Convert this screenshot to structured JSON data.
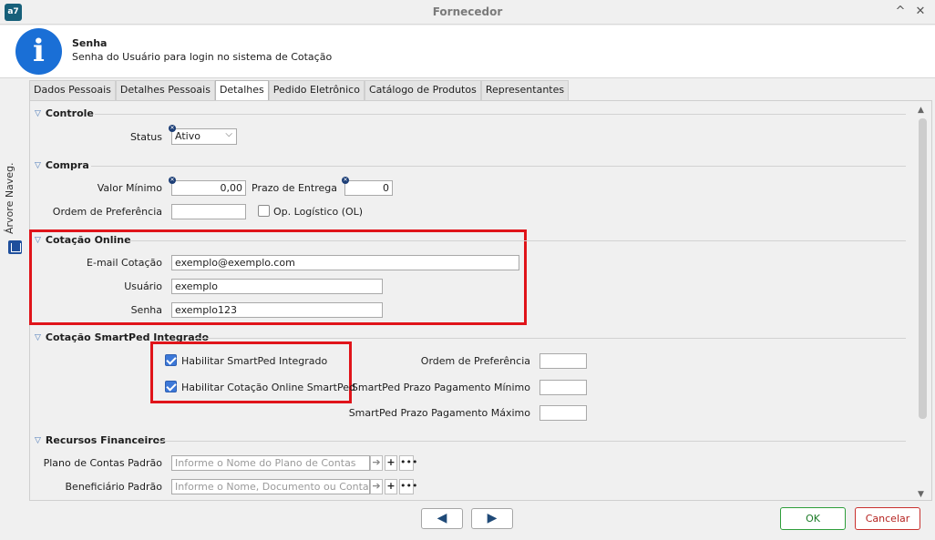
{
  "window": {
    "title": "Fornecedor",
    "logo": "a7",
    "minimize_glyph": "^",
    "close_glyph": "✕"
  },
  "header": {
    "title": "Senha",
    "subtitle": "Senha do Usuário para login no sistema de Cotação",
    "icon": "info-icon"
  },
  "side": {
    "label": "Árvore Naveg."
  },
  "tabs": [
    {
      "label": "Dados Pessoais",
      "active": false
    },
    {
      "label": "Detalhes Pessoais",
      "active": false
    },
    {
      "label": "Detalhes",
      "active": true
    },
    {
      "label": "Pedido Eletrônico",
      "active": false
    },
    {
      "label": "Catálogo de Produtos",
      "active": false
    },
    {
      "label": "Representantes",
      "active": false
    }
  ],
  "controle": {
    "title": "Controle",
    "status_label": "Status",
    "status_value": "Ativo"
  },
  "compra": {
    "title": "Compra",
    "valor_minimo_label": "Valor Mínimo",
    "valor_minimo_value": "0,00",
    "prazo_label": "Prazo de Entrega",
    "prazo_value": "0",
    "ordem_label": "Ordem de Preferência",
    "ordem_value": "",
    "op_logistico_label": "Op. Logístico (OL)",
    "op_logistico_checked": false
  },
  "cotacao_online": {
    "title": "Cotação Online",
    "email_label": "E-mail Cotação",
    "email_value": "exemplo@exemplo.com",
    "usuario_label": "Usuário",
    "usuario_value": "exemplo",
    "senha_label": "Senha",
    "senha_value": "exemplo123"
  },
  "smartped": {
    "title": "Cotação SmartPed Integrado",
    "habilitar_integrado_label": "Habilitar SmartPed Integrado",
    "habilitar_integrado_checked": true,
    "habilitar_online_label": "Habilitar Cotação Online SmartPed",
    "habilitar_online_checked": true,
    "ordem_label": "Ordem de Preferência",
    "prazo_min_label": "SmartPed Prazo Pagamento Mínimo",
    "prazo_max_label": "SmartPed Prazo Pagamento Máximo"
  },
  "financeiros": {
    "title": "Recursos Financeiros",
    "plano_label": "Plano de Contas Padrão",
    "plano_placeholder": "Informe o Nome do Plano de Contas",
    "beneficiario_label": "Beneficiário Padrão",
    "beneficiario_placeholder": "Informe o Nome, Documento ou Contato"
  },
  "footer": {
    "ok_label": "OK",
    "cancel_label": "Cancelar",
    "prev_glyph": "◀",
    "next_glyph": "▶"
  },
  "colors": {
    "highlight": "#e0141a",
    "ok": "#2e9e3a",
    "cancel": "#c9312e",
    "accent": "#1a6fd6"
  }
}
